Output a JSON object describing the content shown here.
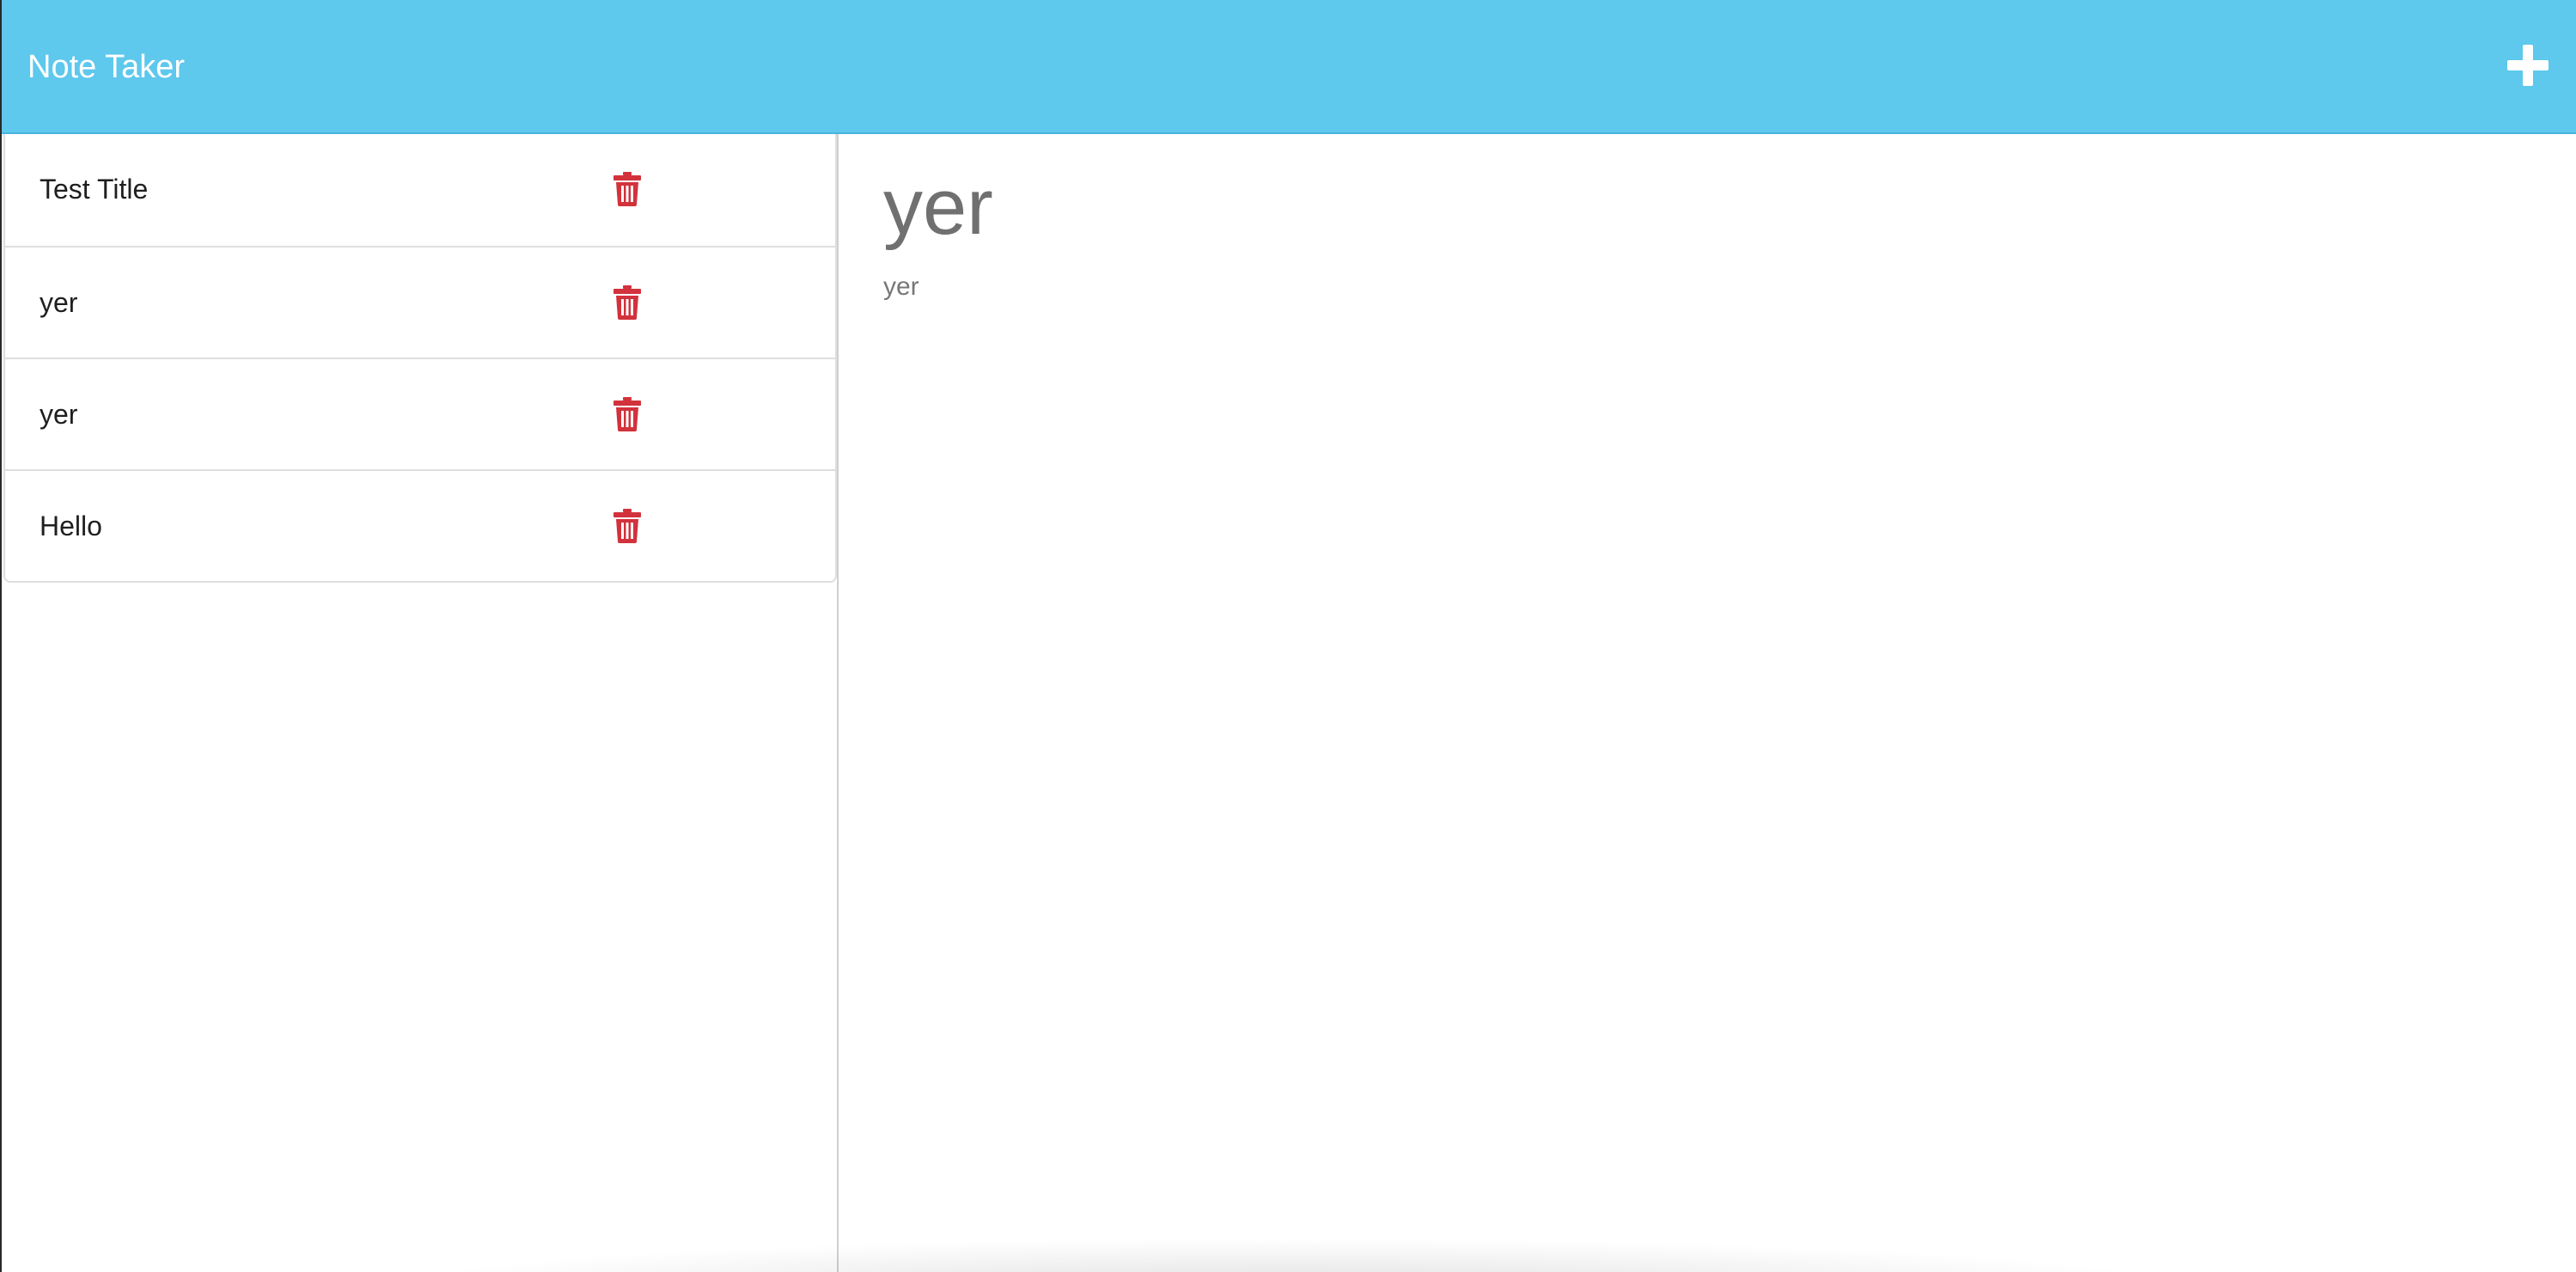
{
  "navbar": {
    "brand": "Note Taker",
    "add_button_icon": "plus-icon",
    "background_color": "#5ec8ed"
  },
  "notes": [
    {
      "title": "Test Title",
      "delete_icon": "trash-icon"
    },
    {
      "title": "yer",
      "delete_icon": "trash-icon"
    },
    {
      "title": "yer",
      "delete_icon": "trash-icon"
    },
    {
      "title": "Hello",
      "delete_icon": "trash-icon"
    }
  ],
  "active_note": {
    "title": "yer",
    "text": "yer"
  },
  "colors": {
    "delete_icon": "#d2323c",
    "heading_text": "#707070"
  }
}
